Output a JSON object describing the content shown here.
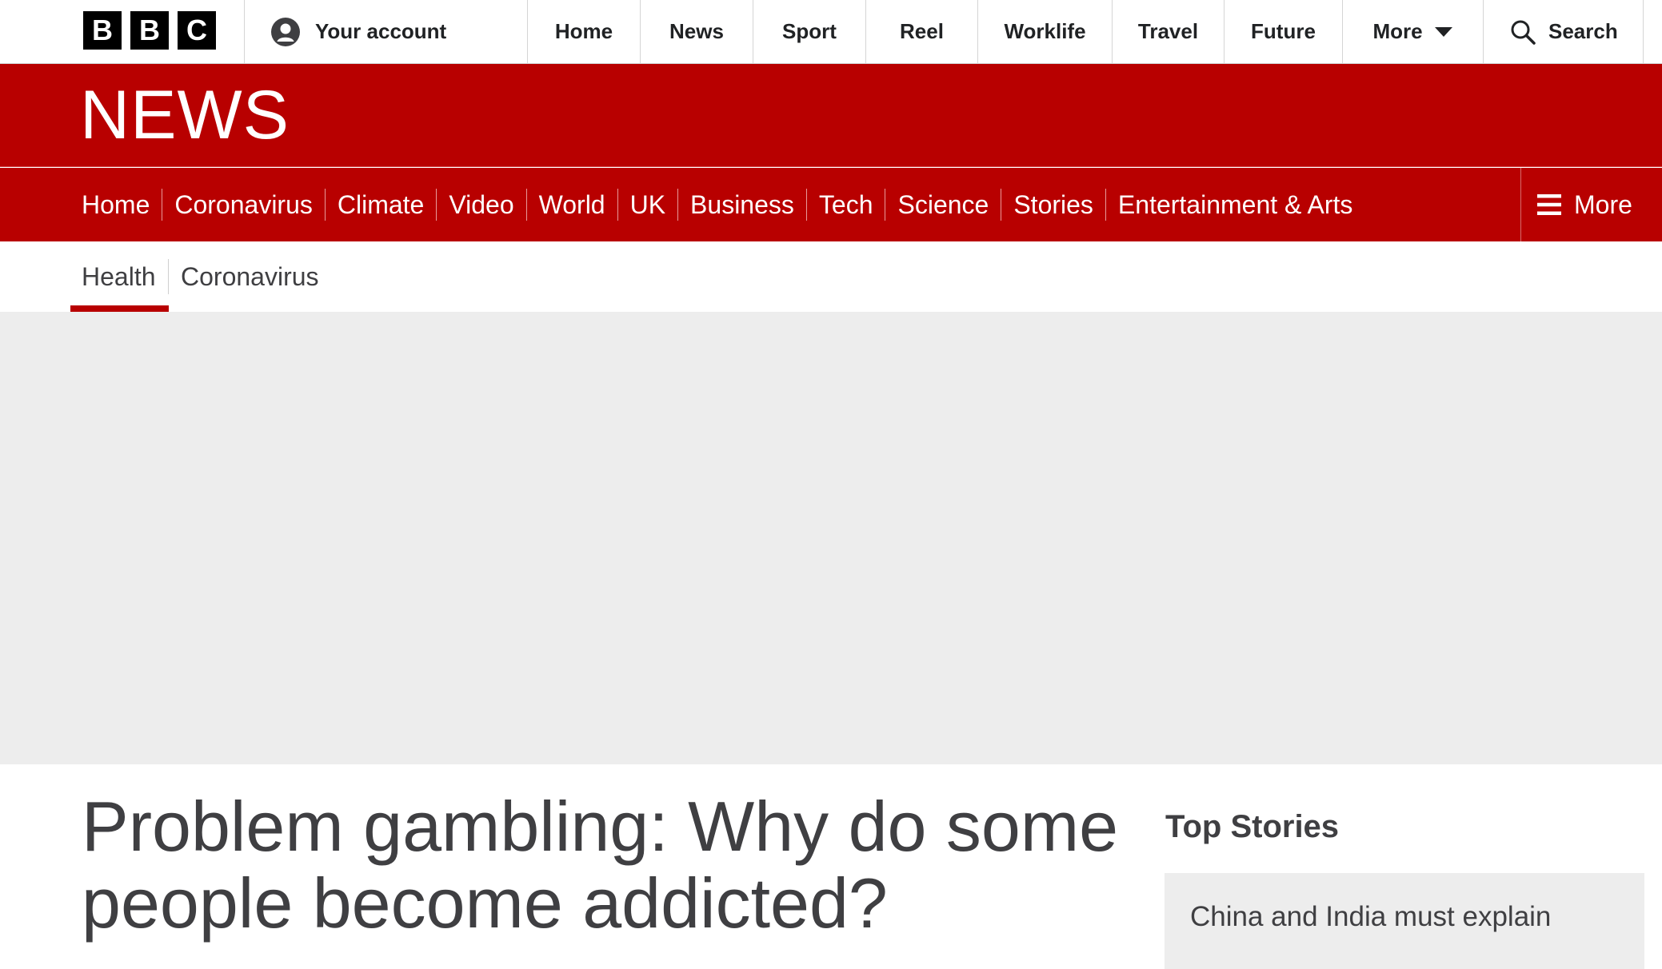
{
  "global_nav": {
    "logo_letters": [
      "B",
      "B",
      "C"
    ],
    "account_label": "Your account",
    "items": [
      "Home",
      "News",
      "Sport",
      "Reel",
      "Worklife",
      "Travel",
      "Future"
    ],
    "more_label": "More",
    "search_label": "Search"
  },
  "news_banner": {
    "wordmark": "NEWS"
  },
  "section_nav": {
    "items": [
      "Home",
      "Coronavirus",
      "Climate",
      "Video",
      "World",
      "UK",
      "Business",
      "Tech",
      "Science",
      "Stories",
      "Entertainment & Arts"
    ],
    "more_label": "More"
  },
  "sub_nav": {
    "items": [
      "Health",
      "Coronavirus"
    ],
    "active": "Health"
  },
  "article": {
    "headline": "Problem gambling: Why do some people become addicted?"
  },
  "top_stories": {
    "title": "Top Stories",
    "first_story": "China and India must explain"
  },
  "colors": {
    "brand_red": "#b80000",
    "placeholder_grey": "#ededed",
    "text": "#3f3f42"
  }
}
